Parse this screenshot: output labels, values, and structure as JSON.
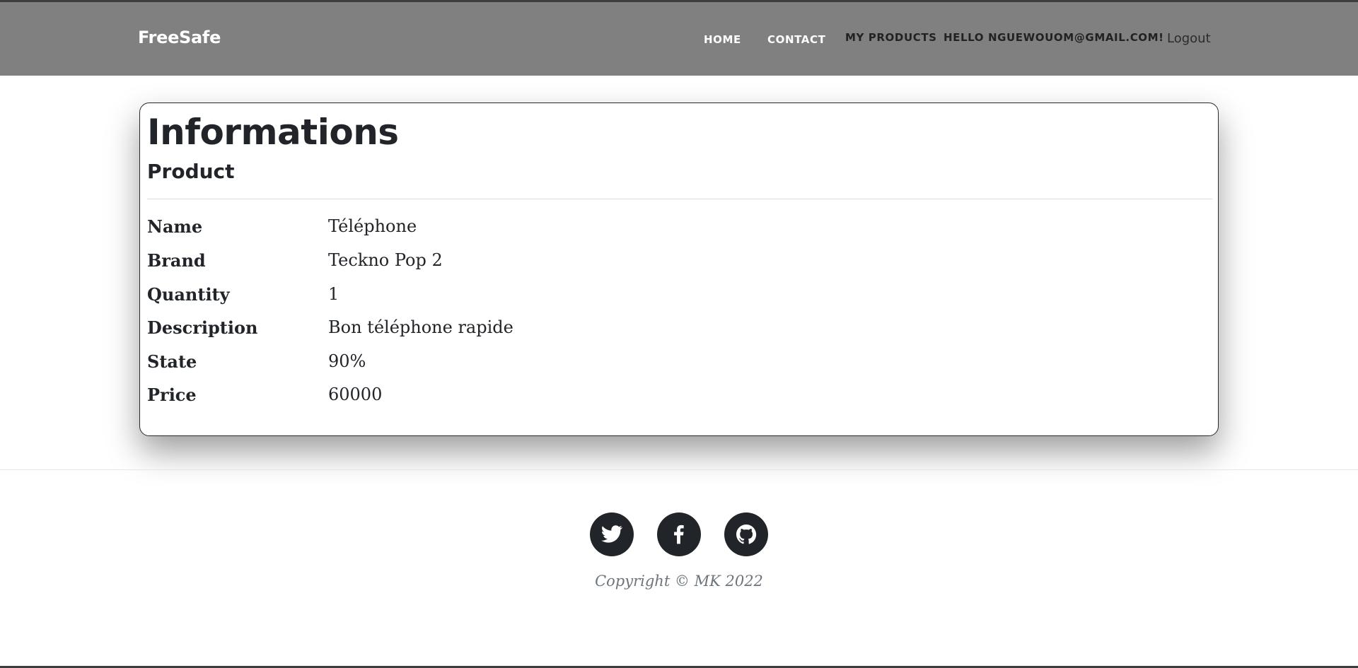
{
  "navbar": {
    "brand": "FreeSafe",
    "links": {
      "home": "HOME",
      "contact": "CONTACT",
      "my_products": "MY PRODUCTS",
      "greeting": "HELLO NGUEWOUOM@GMAIL.COM!",
      "logout": "Logout"
    },
    "background_color": "#808080"
  },
  "card": {
    "title": "Informations",
    "subtitle": "Product",
    "fields": [
      {
        "label": "Name",
        "value": "Téléphone"
      },
      {
        "label": "Brand",
        "value": "Teckno Pop 2"
      },
      {
        "label": "Quantity",
        "value": "1"
      },
      {
        "label": "Description",
        "value": "Bon téléphone rapide"
      },
      {
        "label": "State",
        "value": "90%"
      },
      {
        "label": "Price",
        "value": "60000"
      }
    ]
  },
  "footer": {
    "social_icons": [
      "twitter-icon",
      "facebook-icon",
      "github-icon"
    ],
    "copyright": "Copyright © MK 2022"
  }
}
